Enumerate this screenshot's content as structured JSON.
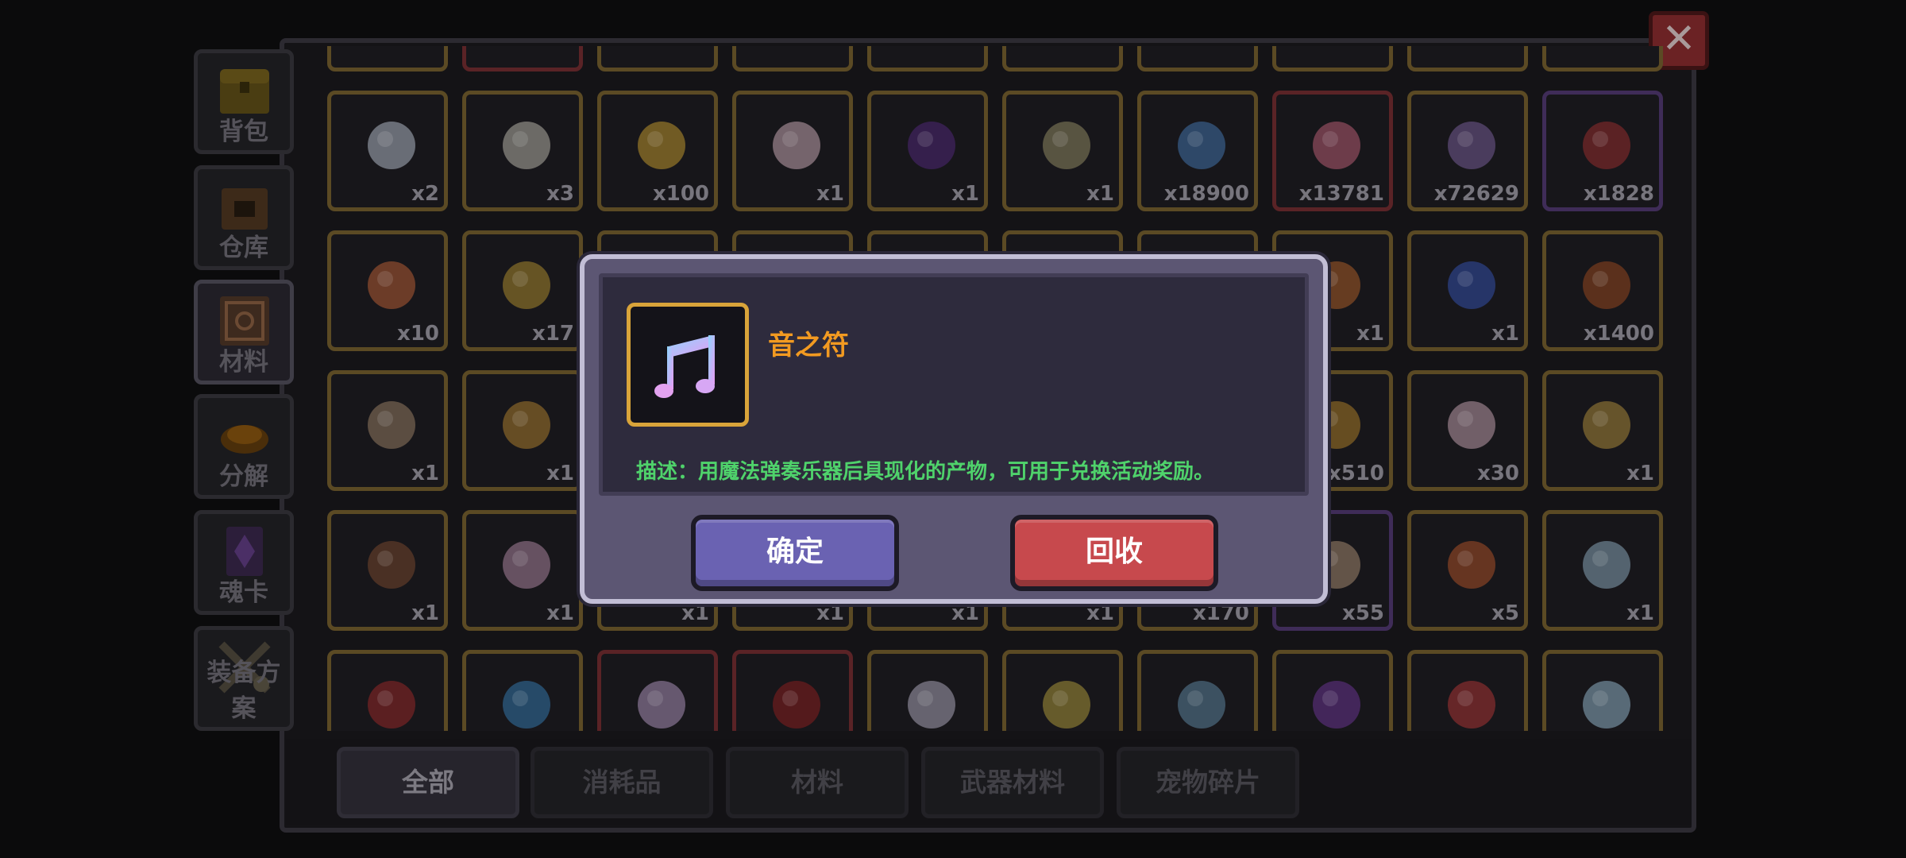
{
  "close_label": "✕",
  "side_tabs": [
    {
      "label": "背包",
      "icon": "chest-icon"
    },
    {
      "label": "仓库",
      "icon": "warehouse-icon"
    },
    {
      "label": "材料",
      "icon": "materials-icon",
      "active": true
    },
    {
      "label": "分解",
      "icon": "disassemble-icon"
    },
    {
      "label": "魂卡",
      "icon": "soul-card-icon"
    },
    {
      "label": "装备方案",
      "icon": "equipment-plan-icon"
    }
  ],
  "filter_tabs": [
    {
      "label": "全部",
      "active": true
    },
    {
      "label": "消耗品"
    },
    {
      "label": "材料"
    },
    {
      "label": "武器材料"
    },
    {
      "label": "宠物碎片"
    }
  ],
  "inventory_rows": [
    [
      {
        "icon": "dumpling-icon",
        "count": "x2"
      },
      {
        "icon": "bottle-icon",
        "count": "x3"
      },
      {
        "icon": "lollipop-icon",
        "count": "x100"
      },
      {
        "icon": "cream-icon",
        "count": "x1"
      },
      {
        "icon": "purple-star-icon",
        "count": "x1"
      },
      {
        "icon": "frog-medal-icon",
        "count": "x1"
      },
      {
        "icon": "blue-gem-icon",
        "count": "x18900"
      },
      {
        "icon": "pink-flower-icon",
        "count": "x13781",
        "rarity": "red"
      },
      {
        "icon": "purple-flower-icon",
        "count": "x72629"
      },
      {
        "icon": "hourglass-icon",
        "count": "x1828",
        "rarity": "purple"
      }
    ],
    [
      {
        "icon": "lotus-icon",
        "count": "x10"
      },
      {
        "icon": "gold-cross-icon",
        "count": "x17"
      },
      {
        "icon": "",
        "count": ""
      },
      {
        "icon": "",
        "count": ""
      },
      {
        "icon": "",
        "count": ""
      },
      {
        "icon": "",
        "count": ""
      },
      {
        "icon": "",
        "count": ""
      },
      {
        "icon": "orange-flower-icon",
        "count": "x1"
      },
      {
        "icon": "blue-rose-icon",
        "count": "x1"
      },
      {
        "icon": "roast-icon",
        "count": "x1400"
      }
    ],
    [
      {
        "icon": "scroll-icon",
        "count": "x1"
      },
      {
        "icon": "firework-icon",
        "count": "x1"
      },
      {
        "icon": "",
        "count": ""
      },
      {
        "icon": "",
        "count": ""
      },
      {
        "icon": "",
        "count": ""
      },
      {
        "icon": "",
        "count": ""
      },
      {
        "icon": "",
        "count": ""
      },
      {
        "icon": "bell-icon",
        "count": "x510"
      },
      {
        "icon": "letter-icon",
        "count": "x30"
      },
      {
        "icon": "gold-pile-icon",
        "count": "x1"
      }
    ],
    [
      {
        "icon": "mushroom-icon",
        "count": "x1"
      },
      {
        "icon": "pink-orb-icon",
        "count": "x1"
      },
      {
        "icon": "",
        "count": "x1"
      },
      {
        "icon": "",
        "count": "x1"
      },
      {
        "icon": "",
        "count": "x1"
      },
      {
        "icon": "",
        "count": "x1"
      },
      {
        "icon": "",
        "count": "x170"
      },
      {
        "icon": "cake-icon",
        "count": "x55",
        "rarity": "purple"
      },
      {
        "icon": "clock-icon",
        "count": "x5"
      },
      {
        "icon": "snow-orb-icon",
        "count": "x1"
      }
    ],
    [
      {
        "icon": "red-pouch-icon",
        "count": ""
      },
      {
        "icon": "pinwheel-icon",
        "count": ""
      },
      {
        "icon": "star-ticket-icon",
        "count": "",
        "rarity": "red"
      },
      {
        "icon": "chinese-knot-icon",
        "count": "",
        "rarity": "red"
      },
      {
        "icon": "white-flower-icon",
        "count": ""
      },
      {
        "icon": "party-popper-icon",
        "count": ""
      },
      {
        "icon": "screw-icon",
        "count": ""
      },
      {
        "icon": "purple-gem-icon",
        "count": ""
      },
      {
        "icon": "red-rose-icon",
        "count": ""
      },
      {
        "icon": "ice-wing-icon",
        "count": ""
      }
    ]
  ],
  "dialog": {
    "item_name": "音之符",
    "item_icon": "music-note-icon",
    "description": "描述：用魔法弹奏乐器后具现化的产物，可用于兑换活动奖励。",
    "confirm_label": "确定",
    "recycle_label": "回收"
  },
  "colors": {
    "item_name": "#f29a21",
    "description": "#4fd26b",
    "confirm_button": "#6a62b2",
    "recycle_button": "#c7494d",
    "dialog_frame": "#5c5673"
  }
}
